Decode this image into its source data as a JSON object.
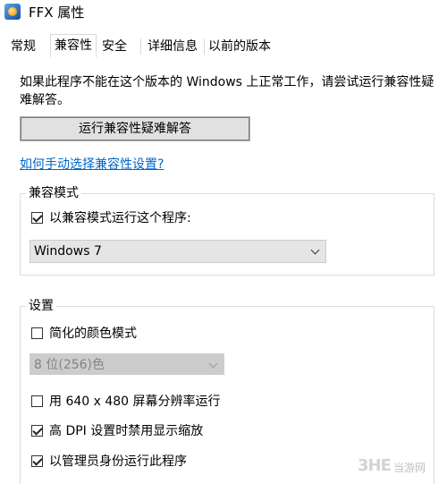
{
  "window": {
    "title": "FFX 属性"
  },
  "tabs": [
    {
      "label": "常规"
    },
    {
      "label": "兼容性"
    },
    {
      "label": "安全"
    },
    {
      "label": "详细信息"
    },
    {
      "label": "以前的版本"
    }
  ],
  "compat": {
    "intro": "如果此程序不能在这个版本的 Windows 上正常工作，请尝试运行兼容性疑难解答。",
    "troubleshoot_button": "运行兼容性疑难解答",
    "help_link": "如何手动选择兼容性设置?"
  },
  "compat_mode": {
    "group_title": "兼容模式",
    "checkbox_label": "以兼容模式运行这个程序:",
    "checkbox_checked": true,
    "os_selected": "Windows 7"
  },
  "settings": {
    "group_title": "设置",
    "reduced_color_label": "简化的颜色模式",
    "reduced_color_checked": false,
    "color_depth_selected": "8 位(256)色",
    "res_640_label": "用 640 x 480 屏幕分辨率运行",
    "res_640_checked": false,
    "high_dpi_label": "高 DPI 设置时禁用显示缩放",
    "high_dpi_checked": true,
    "run_admin_label": "以管理员身份运行此程序",
    "run_admin_checked": true
  },
  "watermark": {
    "logo": "3HE",
    "text": "当游网"
  }
}
